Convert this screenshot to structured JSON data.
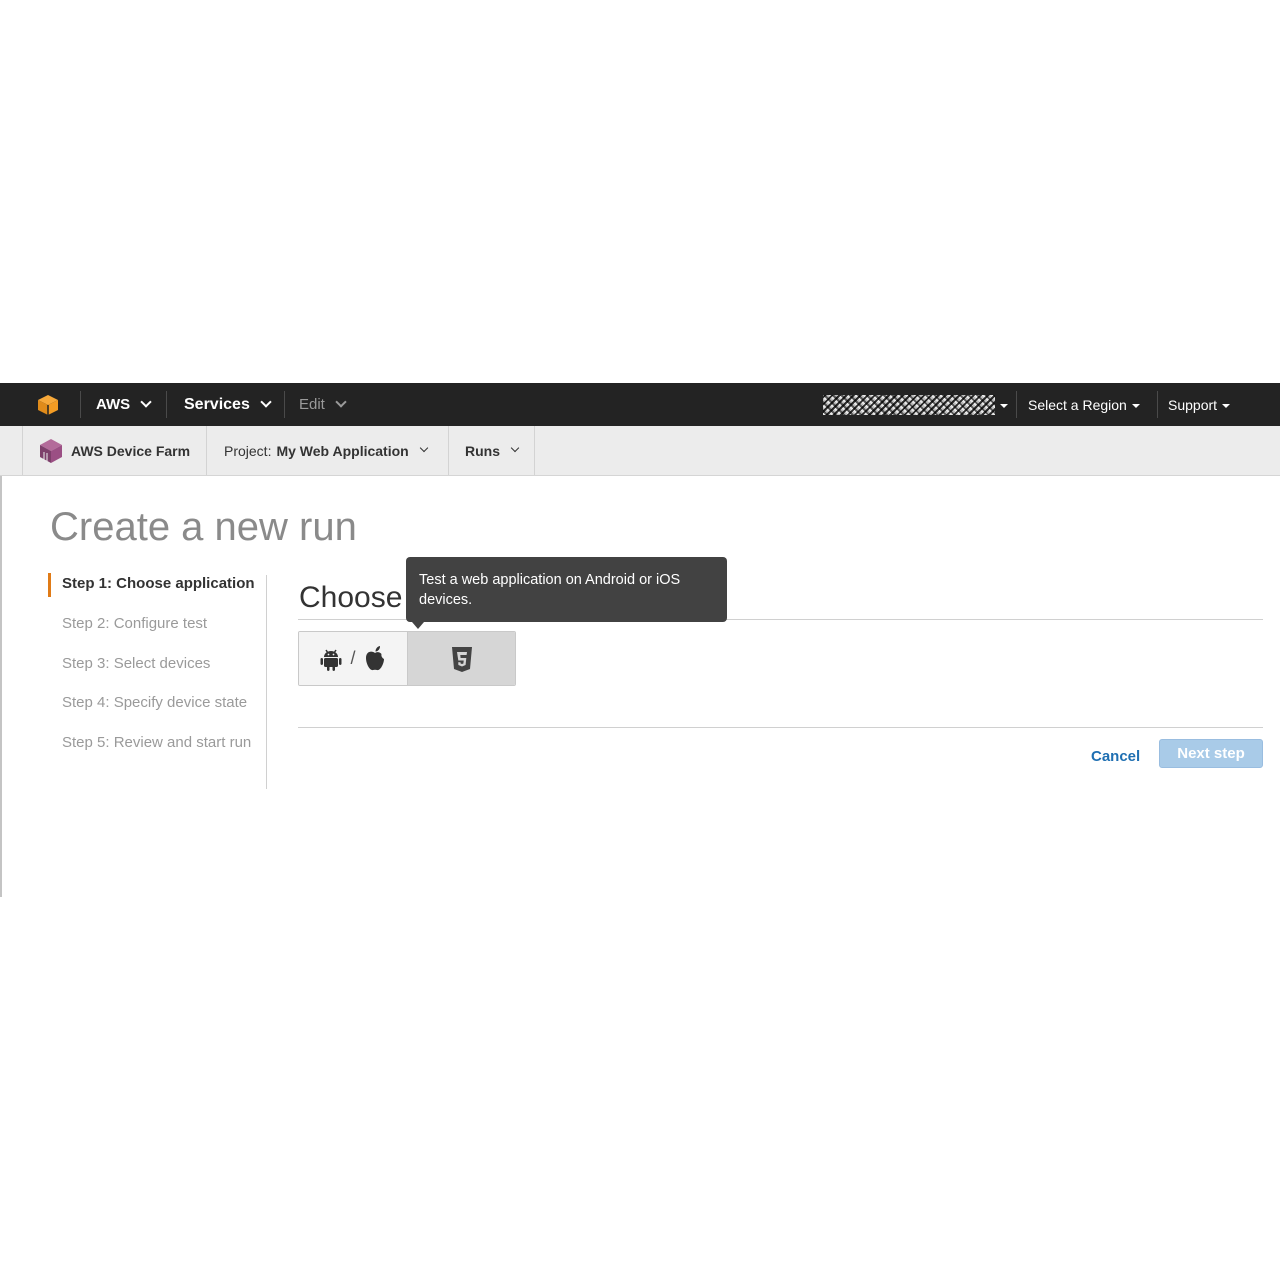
{
  "topbar": {
    "aws_label": "AWS",
    "services_label": "Services",
    "edit_label": "Edit",
    "region_label": "Select a Region",
    "support_label": "Support"
  },
  "subnav": {
    "service_name": "AWS Device Farm",
    "project_prefix": "Project:",
    "project_name": "My Web Application",
    "runs_label": "Runs"
  },
  "page": {
    "title": "Create a new run",
    "section_title": "Choose"
  },
  "steps": [
    {
      "label": "Step 1: Choose application",
      "active": true
    },
    {
      "label": "Step 2: Configure test",
      "active": false
    },
    {
      "label": "Step 3: Select devices",
      "active": false
    },
    {
      "label": "Step 4: Specify device state",
      "active": false
    },
    {
      "label": "Step 5: Review and start run",
      "active": false
    }
  ],
  "app_type": {
    "options": [
      "android-apple-icons",
      "html5-icon"
    ],
    "slash": "/",
    "selected": "web"
  },
  "tooltip": {
    "text": "Test a web application on Android or iOS devices."
  },
  "actions": {
    "cancel_label": "Cancel",
    "next_label": "Next step"
  },
  "colors": {
    "topbar_bg": "#232323",
    "accent_orange": "#e07b17",
    "link_blue": "#1f6fb2",
    "next_disabled": "#a9cbe8"
  }
}
